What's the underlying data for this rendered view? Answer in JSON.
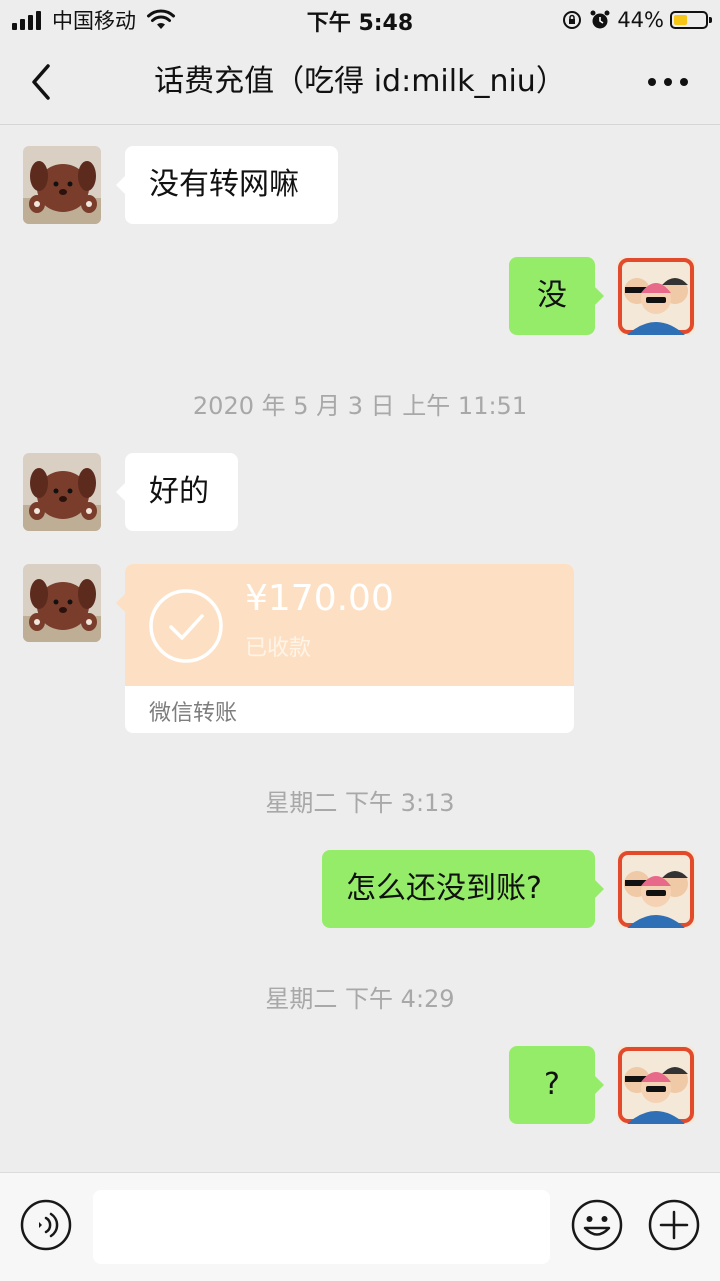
{
  "status_bar": {
    "carrier": "中国移动",
    "time": "下午 5:48",
    "battery": "44%",
    "battery_level": 0.44,
    "battery_color": "#f5c518"
  },
  "header": {
    "title": "话费充值（吃得 id:milk_niu）",
    "back_icon": "chevron-left-icon",
    "more_icon": "more-dots-icon"
  },
  "messages": [
    {
      "side": "in",
      "type": "text",
      "text": "没有转网嘛",
      "avatar": "plush-dog-avatar"
    },
    {
      "side": "out",
      "type": "text",
      "text": "没",
      "avatar": "cartoon-group-avatar"
    },
    {
      "type": "time",
      "text": "2020 年 5 月 3 日  上午 11:51"
    },
    {
      "side": "in",
      "type": "text",
      "text": "好的",
      "avatar": "plush-dog-avatar"
    },
    {
      "side": "in",
      "type": "transfer",
      "amount": "¥170.00",
      "status": "已收款",
      "label": "微信转账",
      "avatar": "plush-dog-avatar"
    },
    {
      "type": "time",
      "text": "星期二 下午 3:13"
    },
    {
      "side": "out",
      "type": "text",
      "text": "怎么还没到账?",
      "avatar": "cartoon-group-avatar"
    },
    {
      "type": "time",
      "text": "星期二 下午 4:29"
    },
    {
      "side": "out",
      "type": "text",
      "text": "?",
      "avatar": "cartoon-group-avatar"
    }
  ],
  "input_bar": {
    "input_value": "",
    "voice_icon": "voice-icon",
    "emoji_icon": "emoji-icon",
    "plus_icon": "plus-icon"
  },
  "colors": {
    "background": "#ededed",
    "outgoing_bubble": "#95ec69",
    "incoming_bubble": "#ffffff",
    "transfer_card": "#fde0c3"
  }
}
